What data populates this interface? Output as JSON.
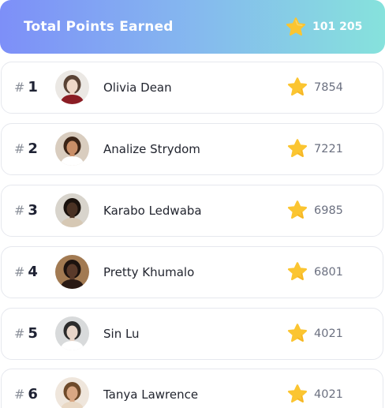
{
  "header": {
    "title": "Total Points Earned",
    "total_points": "101 205",
    "icon": "star-icon"
  },
  "leaderboard": [
    {
      "rank": "1",
      "name": "Olivia Dean",
      "points": "7854",
      "avatar": {
        "skin": "#efd8c8",
        "hair": "#5a4335",
        "bg": "#ebe8e4",
        "top": "#8b1d24"
      }
    },
    {
      "rank": "2",
      "name": "Analize Strydom",
      "points": "7221",
      "avatar": {
        "skin": "#c98e67",
        "hair": "#3b2416",
        "bg": "#d9cdbf",
        "top": "#ffffff"
      }
    },
    {
      "rank": "3",
      "name": "Karabo Ledwaba",
      "points": "6985",
      "avatar": {
        "skin": "#4a3224",
        "hair": "#1a120d",
        "bg": "#d8d4cc",
        "top": "#d6c8b4"
      }
    },
    {
      "rank": "4",
      "name": "Pretty Khumalo",
      "points": "6801",
      "avatar": {
        "skin": "#5a3a2a",
        "hair": "#1c120e",
        "bg": "#a27a52",
        "top": "#2a1a14"
      }
    },
    {
      "rank": "5",
      "name": "Sin Lu",
      "points": "4021",
      "avatar": {
        "skin": "#e8d5c8",
        "hair": "#2b2b2b",
        "bg": "#d8dadb",
        "top": "#ffffff"
      }
    },
    {
      "rank": "6",
      "name": "Tanya Lawrence",
      "points": "4021",
      "avatar": {
        "skin": "#d9a783",
        "hair": "#6e4a2a",
        "bg": "#efe6dc",
        "top": "#e9d8c4"
      }
    }
  ],
  "colors": {
    "header_gradient": [
      "#7d8ff8",
      "#85b8ef",
      "#86e2dc"
    ],
    "star": "#fbc531",
    "star_dark": "#f0a41c"
  }
}
